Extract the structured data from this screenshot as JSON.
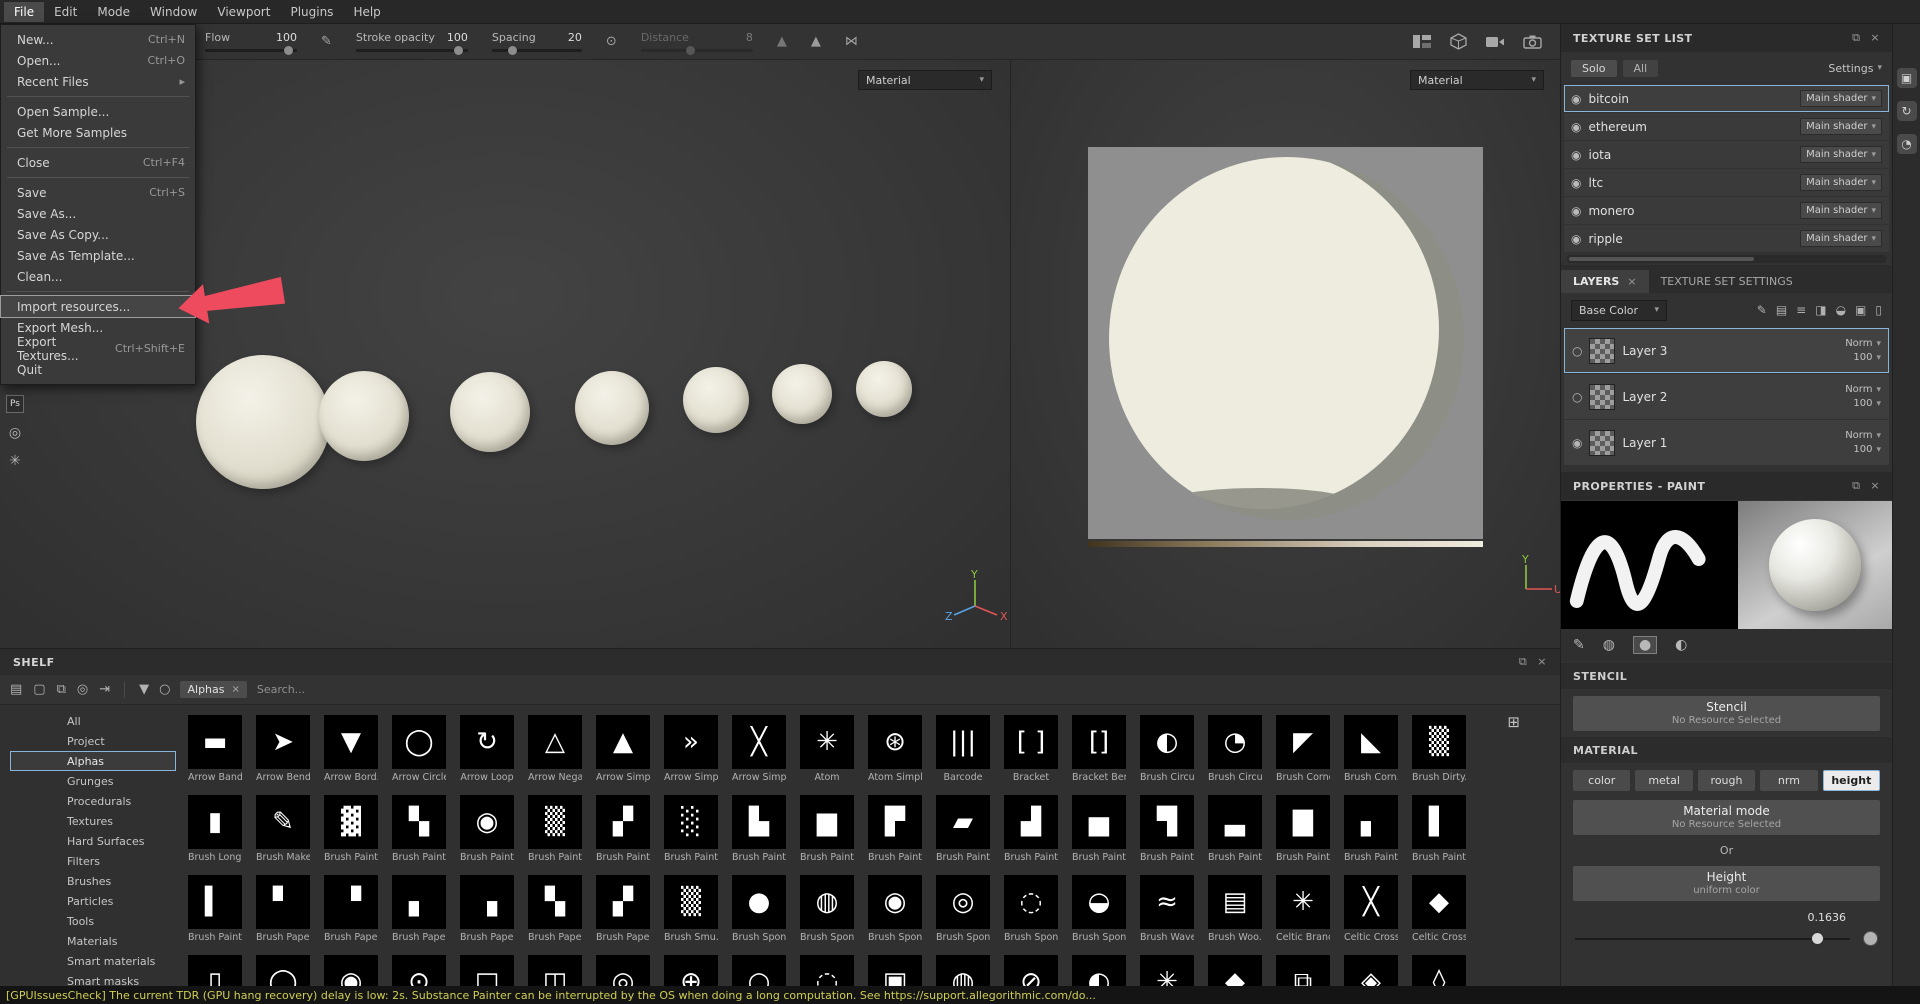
{
  "menubar": {
    "active": "File",
    "items": [
      "File",
      "Edit",
      "Mode",
      "Window",
      "Viewport",
      "Plugins",
      "Help"
    ]
  },
  "file_menu": {
    "items": [
      {
        "label": "New...",
        "shortcut": "Ctrl+N"
      },
      {
        "label": "Open...",
        "shortcut": "Ctrl+O"
      },
      {
        "label": "Recent Files",
        "submenu": true,
        "sep_after": true
      },
      {
        "label": "Open Sample..."
      },
      {
        "label": "Get More Samples",
        "sep_after": true
      },
      {
        "label": "Close",
        "shortcut": "Ctrl+F4",
        "sep_after": true
      },
      {
        "label": "Save",
        "shortcut": "Ctrl+S"
      },
      {
        "label": "Save As..."
      },
      {
        "label": "Save As Copy..."
      },
      {
        "label": "Save As Template..."
      },
      {
        "label": "Clean...",
        "sep_after": true
      },
      {
        "label": "Import resources...",
        "highlighted": true
      },
      {
        "label": "Export Mesh..."
      },
      {
        "label": "Export Textures...",
        "shortcut": "Ctrl+Shift+E"
      },
      {
        "label": "Quit"
      }
    ]
  },
  "toolbar": {
    "flow": {
      "label": "Flow",
      "value": "100"
    },
    "stroke_opacity": {
      "label": "Stroke opacity",
      "value": "100"
    },
    "spacing": {
      "label": "Spacing",
      "value": "20"
    },
    "distance": {
      "label": "Distance",
      "value": "8"
    }
  },
  "viewport3d": {
    "material_label": "Material",
    "axes": {
      "x": "X",
      "y": "Y",
      "z": "Z"
    },
    "plugin_badge": "Ps"
  },
  "viewport2d": {
    "material_label": "Material",
    "axes": {
      "y": "Y",
      "u": "U"
    }
  },
  "texture_set_list": {
    "title": "TEXTURE SET LIST",
    "solo_label": "Solo",
    "all_label": "All",
    "settings_label": "Settings",
    "sets": [
      {
        "name": "bitcoin",
        "shader": "Main shader",
        "selected": true
      },
      {
        "name": "ethereum",
        "shader": "Main shader"
      },
      {
        "name": "iota",
        "shader": "Main shader"
      },
      {
        "name": "ltc",
        "shader": "Main shader"
      },
      {
        "name": "monero",
        "shader": "Main shader"
      },
      {
        "name": "ripple",
        "shader": "Main shader"
      }
    ]
  },
  "layers_panel": {
    "tab_layers": "LAYERS",
    "tab_texture_set_settings": "TEXTURE SET SETTINGS",
    "channel_selector": "Base Color",
    "toolbar_icons": [
      {
        "name": "paint-tool-icon",
        "glyph": "✎"
      },
      {
        "name": "add-layer-icon",
        "glyph": "▤"
      },
      {
        "name": "add-effect-icon",
        "glyph": "≡"
      },
      {
        "name": "add-mask-icon",
        "glyph": "◨"
      },
      {
        "name": "add-fill-icon",
        "glyph": "◒"
      },
      {
        "name": "add-folder-icon",
        "glyph": "▣"
      },
      {
        "name": "delete-layer-icon",
        "glyph": "▯"
      }
    ],
    "layers": [
      {
        "name": "Layer 3",
        "blend": "Norm",
        "opacity": "100",
        "selected": true,
        "active": false
      },
      {
        "name": "Layer 2",
        "blend": "Norm",
        "opacity": "100",
        "selected": false,
        "active": false
      },
      {
        "name": "Layer 1",
        "blend": "Norm",
        "opacity": "100",
        "selected": false,
        "active": true
      }
    ]
  },
  "properties": {
    "title": "PROPERTIES - PAINT",
    "mode_icons": [
      {
        "name": "brush-icon",
        "glyph": "✎",
        "selected": false
      },
      {
        "name": "material-ball-icon",
        "glyph": "◍",
        "selected": false
      },
      {
        "name": "solid-color-icon",
        "glyph": "●",
        "selected": true
      },
      {
        "name": "half-sphere-icon",
        "glyph": "◐",
        "selected": false
      }
    ]
  },
  "stencil": {
    "title": "STENCIL",
    "button_label": "Stencil",
    "button_sub": "No Resource Selected"
  },
  "material": {
    "title": "MATERIAL",
    "channels": [
      "color",
      "metal",
      "rough",
      "nrm",
      "height"
    ],
    "selected_channel": "height",
    "mode_label": "Material mode",
    "mode_sub": "No Resource Selected",
    "or_label": "Or",
    "height_label": "Height",
    "height_sub": "uniform color",
    "height_value": "0.1636"
  },
  "right_strip": {
    "icons": [
      {
        "name": "resources-panel-icon",
        "glyph": "▣"
      },
      {
        "name": "history-panel-icon",
        "glyph": "↻"
      },
      {
        "name": "shader-panel-icon",
        "glyph": "◔"
      }
    ]
  },
  "shelf": {
    "title": "SHELF",
    "toolbar_icons": [
      {
        "name": "folder-icon",
        "glyph": "▤"
      },
      {
        "name": "new-resource-icon",
        "glyph": "▢"
      },
      {
        "name": "duplicate-icon",
        "glyph": "⧉"
      },
      {
        "name": "hide-icon",
        "glyph": "◎"
      },
      {
        "name": "import-icon",
        "glyph": "⇥"
      }
    ],
    "filter_chip": "Alphas",
    "search_placeholder": "Search...",
    "sidebar": [
      "All",
      "Project",
      "Alphas",
      "Grunges",
      "Procedurals",
      "Textures",
      "Hard Surfaces",
      "Filters",
      "Brushes",
      "Particles",
      "Tools",
      "Materials",
      "Smart materials",
      "Smart masks"
    ],
    "selected_category": "Alphas",
    "rows": [
      [
        {
          "l": "Arrow Band",
          "g": "▬"
        },
        {
          "l": "Arrow Bend...",
          "g": "➤"
        },
        {
          "l": "Arrow Bord...",
          "g": "▼"
        },
        {
          "l": "Arrow Circle",
          "g": "◯"
        },
        {
          "l": "Arrow Loop",
          "g": "↻"
        },
        {
          "l": "Arrow Nega...",
          "g": "△"
        },
        {
          "l": "Arrow Simple",
          "g": "▲"
        },
        {
          "l": "Arrow Simpl...",
          "g": "»"
        },
        {
          "l": "Arrow Simpl...",
          "g": "╳"
        },
        {
          "l": "Atom",
          "g": "✳"
        },
        {
          "l": "Atom Simple",
          "g": "⊛"
        },
        {
          "l": "Barcode",
          "g": "|||"
        },
        {
          "l": "Bracket",
          "g": "[ ]"
        },
        {
          "l": "Bracket Ben...",
          "g": "[]"
        },
        {
          "l": "Brush Circul...",
          "g": "◐"
        },
        {
          "l": "Brush Circul...",
          "g": "◔"
        },
        {
          "l": "Brush Corner",
          "g": "◤"
        },
        {
          "l": "Brush Corn...",
          "g": "◣"
        },
        {
          "l": "Brush Dirty...",
          "g": "▒"
        }
      ],
      [
        {
          "l": "Brush Long...",
          "g": "▮"
        },
        {
          "l": "Brush Maker",
          "g": "✎"
        },
        {
          "l": "Brush Paint...",
          "g": "▓"
        },
        {
          "l": "Brush Paint...",
          "g": "▚"
        },
        {
          "l": "Brush Paint...",
          "g": "◉"
        },
        {
          "l": "Brush Paint...",
          "g": "▒"
        },
        {
          "l": "Brush Paint...",
          "g": "▞"
        },
        {
          "l": "Brush Paint...",
          "g": "░"
        },
        {
          "l": "Brush Paint...",
          "g": "▙"
        },
        {
          "l": "Brush Paint...",
          "g": "▆"
        },
        {
          "l": "Brush Paint...",
          "g": "▛"
        },
        {
          "l": "Brush Paint...",
          "g": "▰"
        },
        {
          "l": "Brush Paint...",
          "g": "▟"
        },
        {
          "l": "Brush Paint...",
          "g": "▅"
        },
        {
          "l": "Brush Paint...",
          "g": "▜"
        },
        {
          "l": "Brush Paint...",
          "g": "▃"
        },
        {
          "l": "Brush Paint...",
          "g": "▇"
        },
        {
          "l": "Brush Paint...",
          "g": "▖"
        },
        {
          "l": "Brush Paint...",
          "g": "▌"
        }
      ],
      [
        {
          "l": "Brush Paint...",
          "g": "▍"
        },
        {
          "l": "Brush Pape...",
          "g": "▘"
        },
        {
          "l": "Brush Pape...",
          "g": "▝"
        },
        {
          "l": "Brush Pape...",
          "g": "▖"
        },
        {
          "l": "Brush Pape...",
          "g": "▗"
        },
        {
          "l": "Brush Pape...",
          "g": "▚"
        },
        {
          "l": "Brush Pape...",
          "g": "▞"
        },
        {
          "l": "Brush Smu...",
          "g": "▒"
        },
        {
          "l": "Brush Spon...",
          "g": "●"
        },
        {
          "l": "Brush Spon...",
          "g": "◍"
        },
        {
          "l": "Brush Spon...",
          "g": "◉"
        },
        {
          "l": "Brush Spon...",
          "g": "◎"
        },
        {
          "l": "Brush Spon...",
          "g": "◌"
        },
        {
          "l": "Brush Spon...",
          "g": "◒"
        },
        {
          "l": "Brush Wave",
          "g": "≈"
        },
        {
          "l": "Brush Woo...",
          "g": "▤"
        },
        {
          "l": "Celtic Branch",
          "g": "✳"
        },
        {
          "l": "Celtic Cross",
          "g": "╳"
        },
        {
          "l": "Celtic Cross...",
          "g": "◆"
        }
      ],
      [
        {
          "l": "",
          "g": "▯"
        },
        {
          "l": "",
          "g": "◯"
        },
        {
          "l": "",
          "g": "◉"
        },
        {
          "l": "",
          "g": "⊙"
        },
        {
          "l": "",
          "g": "□"
        },
        {
          "l": "",
          "g": "◫"
        },
        {
          "l": "",
          "g": "◎"
        },
        {
          "l": "",
          "g": "⊕"
        },
        {
          "l": "",
          "g": "○"
        },
        {
          "l": "",
          "g": "◌"
        },
        {
          "l": "",
          "g": "▣"
        },
        {
          "l": "",
          "g": "◍"
        },
        {
          "l": "",
          "g": "⊘"
        },
        {
          "l": "",
          "g": "◐"
        },
        {
          "l": "",
          "g": "✳"
        },
        {
          "l": "",
          "g": "◆"
        },
        {
          "l": "",
          "g": "⧉"
        },
        {
          "l": "",
          "g": "◈"
        },
        {
          "l": "",
          "g": "◊"
        }
      ]
    ]
  },
  "statusbar": {
    "text": "[GPUIssuesCheck] The current TDR (GPU hang recovery) delay is low: 2s. Substance Painter can be interrupted by the OS when doing a long computation. See https://support.allegorithmic.com/do..."
  },
  "icons": {
    "close": "×",
    "popout": "⧉",
    "caret": "▾",
    "submenu": "▸",
    "radio_on": "◉",
    "radio_off": "○",
    "funnel": "▼",
    "circle": "○",
    "grid_view": "⊞",
    "pen": "✎",
    "dot": "⊙",
    "triangle": "▲",
    "symmetry": "⋈"
  }
}
